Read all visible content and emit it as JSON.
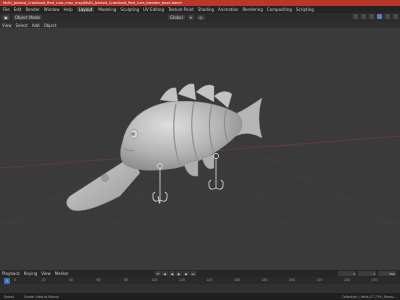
{
  "title_bar": {
    "text": "Multi_Jointed_Crankbait_Red_Lure_max_mxp\\Multi_Jointed_Crankbait_Red_Lure_blender_base.blend"
  },
  "menu": {
    "items": [
      "File",
      "Edit",
      "Render",
      "Window",
      "Help"
    ],
    "tabs": [
      "Layout",
      "Modeling",
      "Sculpting",
      "UV Editing",
      "Texture Paint",
      "Shading",
      "Animation",
      "Rendering",
      "Compositing",
      "Scripting"
    ],
    "active_tab": "Layout"
  },
  "header": {
    "mode": "Object Mode",
    "transform": "Global",
    "viewport_menu": [
      "View",
      "Select",
      "Add",
      "Object"
    ]
  },
  "timeline": {
    "items": [
      "Playback",
      "Keying",
      "View",
      "Marker"
    ],
    "current_frame": "1",
    "start": "1",
    "end": "250",
    "ticks": [
      "0",
      "20",
      "40",
      "60",
      "80",
      "100",
      "120",
      "140",
      "160",
      "180",
      "200",
      "220",
      "240",
      "250"
    ]
  },
  "status": {
    "left": [
      "Select",
      "Center View to Mouse"
    ],
    "right": "Collection | Verts:27,739 | Faces:..."
  },
  "colors": {
    "accent": "#b8362a",
    "frame": "#3e6fb8",
    "mesh": "#b9b9b9"
  }
}
